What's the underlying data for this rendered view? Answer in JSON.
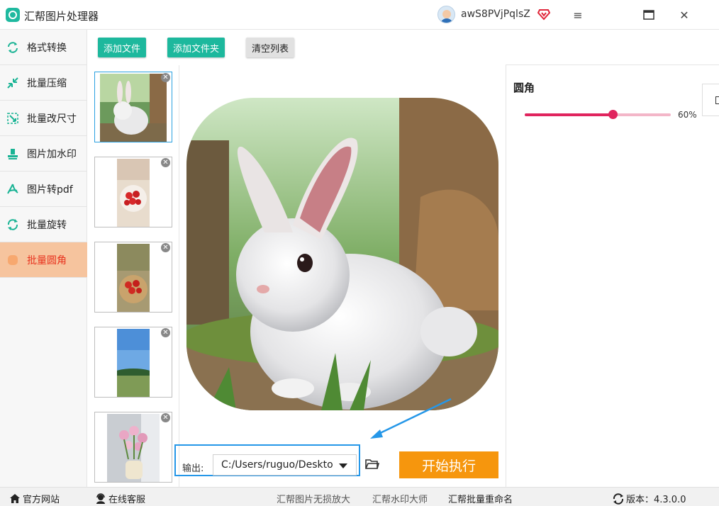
{
  "app": {
    "title": "汇帮图片处理器",
    "username": "awS8PVjPqlsZ"
  },
  "window": {
    "menu_icon": "≡",
    "maximize_icon": "▭",
    "close_icon": "✕"
  },
  "sidebar": {
    "items": [
      {
        "label": "格式转换",
        "icon": "convert-icon"
      },
      {
        "label": "批量压缩",
        "icon": "compress-icon"
      },
      {
        "label": "批量改尺寸",
        "icon": "resize-icon"
      },
      {
        "label": "图片加水印",
        "icon": "watermark-icon"
      },
      {
        "label": "图片转pdf",
        "icon": "pdf-icon"
      },
      {
        "label": "批量旋转",
        "icon": "rotate-icon"
      },
      {
        "label": "批量圆角",
        "icon": "rounded-corner-icon",
        "active": true
      }
    ]
  },
  "toolbar": {
    "add_file": "添加文件",
    "add_folder": "添加文件夹",
    "clear_list": "清空列表"
  },
  "thumbnails": [
    "rabbit",
    "strawberries-plate",
    "strawberry-basket",
    "sky-landscape",
    "tulips-vase"
  ],
  "settings": {
    "label": "圆角",
    "value_text": "60%",
    "value": 0.6
  },
  "output": {
    "label": "输出:",
    "path": "C:/Users/ruguo/Desktop"
  },
  "start_button": "开始执行",
  "statusbar": {
    "website": "官方网站",
    "support": "在线客服",
    "link1": "汇帮图片无损放大",
    "link2": "汇帮水印大师",
    "link3": "汇帮批量重命名",
    "version": "版本：4.3.0.0"
  },
  "colors": {
    "accent": "#1db89d",
    "active_bg": "#f6c49e",
    "active_text": "#e8321d",
    "start": "#f6960d",
    "slider": "#e0245e"
  }
}
